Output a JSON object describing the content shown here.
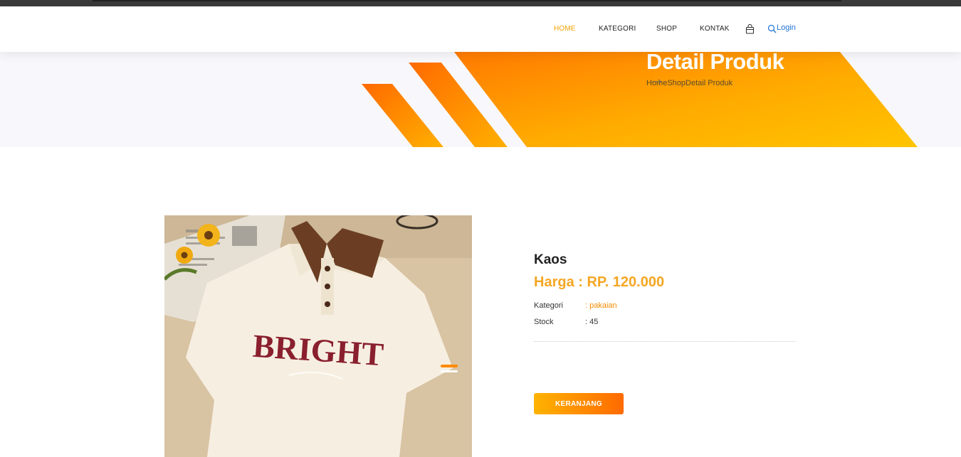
{
  "nav": {
    "items": [
      {
        "label": "HOME",
        "active": true
      },
      {
        "label": "KATEGORI",
        "active": false
      },
      {
        "label": "SHOP",
        "active": false
      },
      {
        "label": "KONTAK",
        "active": false
      }
    ],
    "cart_icon": "cart-icon",
    "search_icon": "search-icon",
    "login_label": "Login"
  },
  "banner": {
    "title": "Detail Produk",
    "breadcrumb": [
      "Home",
      "Shop",
      "Detail Produk"
    ]
  },
  "product": {
    "name": "Kaos",
    "price": "Harga : RP. 120.000",
    "category_label": "Kategori",
    "category_value": ": pakaian",
    "stock_label": "Stock",
    "stock_value": ": 45",
    "image_text": "BRIGHT",
    "cart_button": "KERANJANG"
  },
  "colors": {
    "accent": "#f5a623",
    "link": "#1d73d6",
    "gradient_start": "#ff6a00",
    "gradient_end": "#ffb300"
  }
}
